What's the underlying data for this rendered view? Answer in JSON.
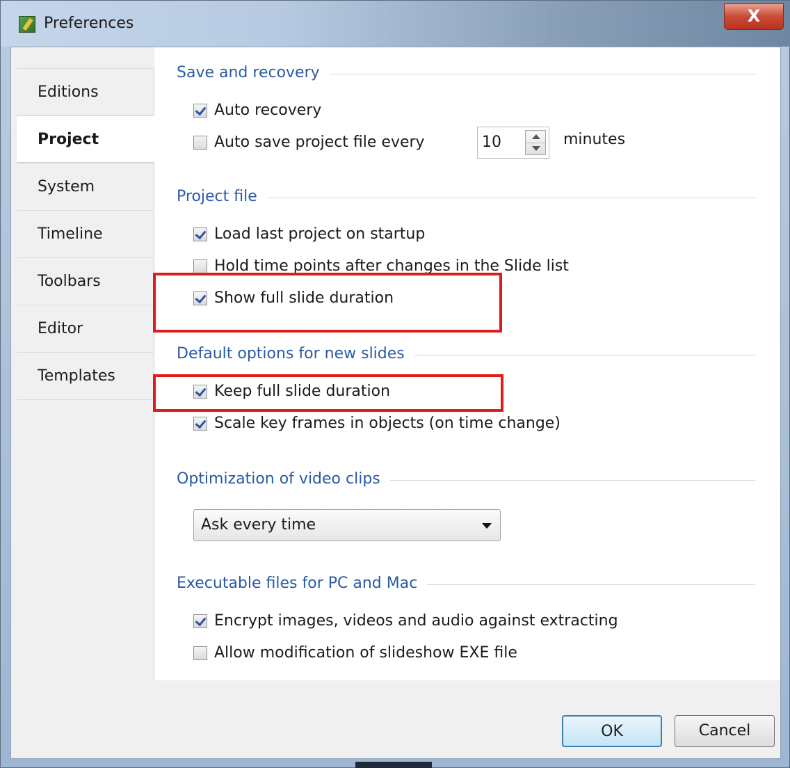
{
  "window": {
    "title": "Preferences",
    "close_label": "X"
  },
  "sidebar": {
    "tabs": [
      {
        "label": "Editions",
        "active": false
      },
      {
        "label": "Project",
        "active": true
      },
      {
        "label": "System",
        "active": false
      },
      {
        "label": "Timeline",
        "active": false
      },
      {
        "label": "Toolbars",
        "active": false
      },
      {
        "label": "Editor",
        "active": false
      },
      {
        "label": "Templates",
        "active": false
      }
    ]
  },
  "save_recovery": {
    "title": "Save and recovery",
    "auto_recovery": {
      "label": "Auto recovery",
      "checked": true
    },
    "auto_save": {
      "label": "Auto save project file every",
      "checked": false
    },
    "interval_value": "10",
    "interval_unit": "minutes"
  },
  "project_file": {
    "title": "Project file",
    "load_last": {
      "label": "Load last project on startup",
      "checked": true
    },
    "hold_time": {
      "label": "Hold time points after changes in the Slide list",
      "checked": false
    },
    "show_full": {
      "label": "Show full slide duration",
      "checked": true
    }
  },
  "default_options": {
    "title": "Default options for new slides",
    "keep_full": {
      "label": "Keep full slide duration",
      "checked": true
    },
    "scale_key": {
      "label": "Scale key frames in objects (on time change)",
      "checked": true
    }
  },
  "video_opt": {
    "title": "Optimization of video clips",
    "selected": "Ask every time"
  },
  "executables": {
    "title": "Executable files for PC and Mac",
    "encrypt": {
      "label": "Encrypt images, videos and audio against extracting",
      "checked": true
    },
    "allow_mod": {
      "label": "Allow modification of slideshow EXE file",
      "checked": false
    }
  },
  "footer": {
    "ok_label": "OK",
    "cancel_label": "Cancel"
  },
  "colors": {
    "group_title": "#2a5aa6",
    "highlight": "#e01b1b",
    "close_button": "#c94b36"
  }
}
